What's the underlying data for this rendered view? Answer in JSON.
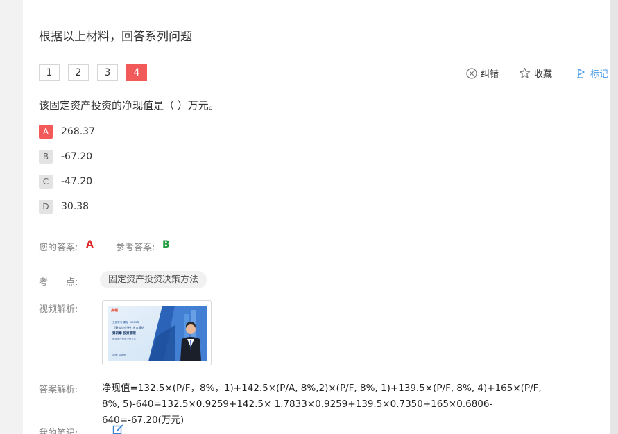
{
  "material_title": "根据以上材料，回答系列问题",
  "question_nav": [
    "1",
    "2",
    "3",
    "4"
  ],
  "active_question": "4",
  "tools": {
    "report_label": "纠错",
    "favorite_label": "收藏",
    "mark_label": "标记"
  },
  "question": {
    "stem": "该固定资产投资的净现值是（ ）万元。",
    "options": [
      {
        "letter": "A",
        "value": "268.37"
      },
      {
        "letter": "B",
        "value": "-67.20"
      },
      {
        "letter": "C",
        "value": "-47.20"
      },
      {
        "letter": "D",
        "value": "30.38"
      }
    ],
    "selected": "A"
  },
  "answers": {
    "your_label": "您的答案:",
    "your_value": "A",
    "ref_label": "参考答案:",
    "ref_value": "B"
  },
  "knowledge": {
    "label": "考　　点:",
    "tag": "固定资产投资决策方法"
  },
  "video": {
    "label": "视频解析:",
    "brand": "高顿",
    "line1": "立即学习·课程 · 2023年",
    "line2": "《财务与会计》考点精讲",
    "line3": "第四章  投资管理",
    "line4": "固定资产投资决策方法",
    "line5": "讲师：高老师"
  },
  "analysis": {
    "label": "答案解析:",
    "text": "净现值=132.5×(P/F，8%，1)+142.5×(P/A, 8%,2)×(P/F, 8%, 1)+139.5×(P/F, 8%, 4)+165×(P/F, 8%, 5)-640=132.5×0.9259+142.5× 1.7833×0.9259+139.5×0.7350+165×0.6806-640=-67.20(万元)"
  },
  "notes": {
    "label": "我的笔记:"
  },
  "colors": {
    "accent_red": "#f25a5a",
    "wrong_answer": "#e02828",
    "correct_answer": "#1f9a3a",
    "mark_blue": "#4a9be8"
  }
}
